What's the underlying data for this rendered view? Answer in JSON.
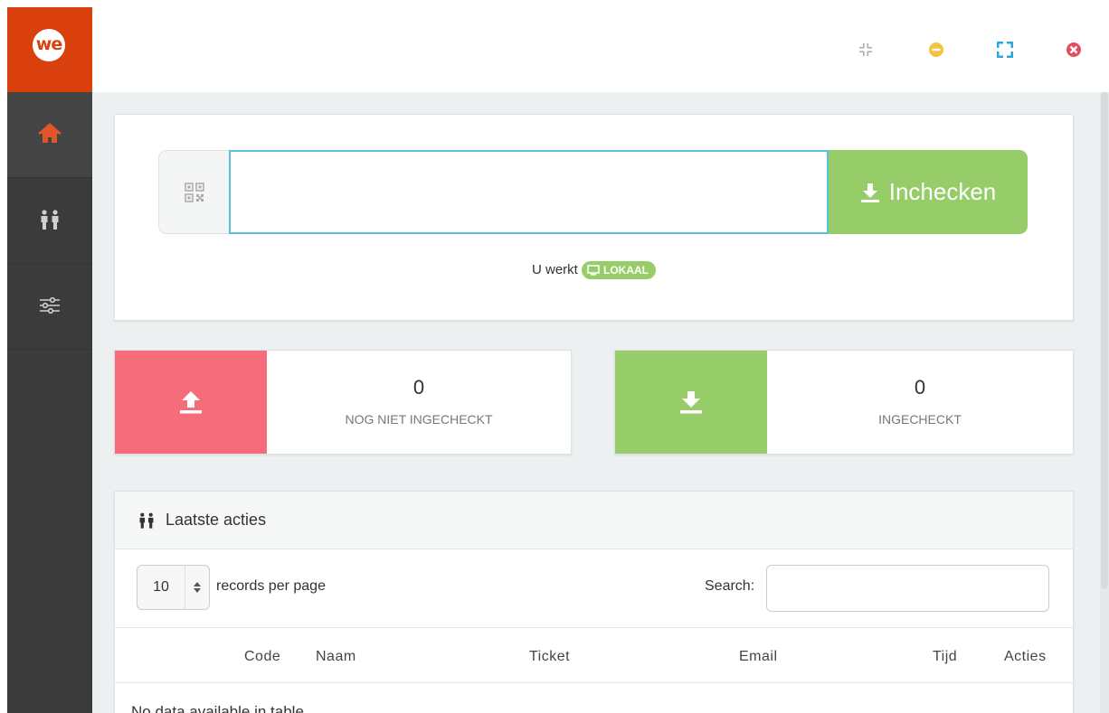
{
  "app": {
    "logo_text": "we"
  },
  "sidebar": {
    "items": [
      {
        "name": "home",
        "icon": "home-icon",
        "active": true
      },
      {
        "name": "attendees",
        "icon": "people-icon",
        "active": false
      },
      {
        "name": "settings",
        "icon": "sliders-icon",
        "active": false
      }
    ]
  },
  "window_controls": [
    {
      "name": "compress",
      "icon": "compress-icon",
      "color": "#aaaaaa"
    },
    {
      "name": "minimize",
      "icon": "minimize-icon",
      "color": "#f5c242"
    },
    {
      "name": "fullscreen",
      "icon": "fullscreen-icon",
      "color": "#29a8e0"
    },
    {
      "name": "close",
      "icon": "close-icon",
      "color": "#e74c5e"
    }
  ],
  "checkin": {
    "input_value": "",
    "input_placeholder": "",
    "qr_icon": "qrcode-icon",
    "button_label": "Inchecken",
    "button_icon": "download-icon",
    "status_prefix": "U werkt",
    "mode_badge": "LOKAAL",
    "mode_icon": "monitor-icon"
  },
  "stats": {
    "not_checked_in": {
      "count": "0",
      "label": "NOG NIET INGECHECKT",
      "color": "#f56d7a",
      "icon": "upload-icon"
    },
    "checked_in": {
      "count": "0",
      "label": "INGECHECKT",
      "color": "#97cd69",
      "icon": "download-icon"
    }
  },
  "recent": {
    "title": "Laatste acties",
    "title_icon": "people-icon",
    "page_length": "10",
    "records_label": "records per page",
    "search_label": "Search:",
    "search_value": "",
    "columns": [
      "Code",
      "Naam",
      "Ticket",
      "Email",
      "Tijd",
      "Acties"
    ],
    "empty_text": "No data available in table"
  },
  "colors": {
    "brand": "#d9400e",
    "accent_green": "#97cd69",
    "accent_red": "#f56d7a",
    "sidebar_bg": "#3b3b3b"
  }
}
